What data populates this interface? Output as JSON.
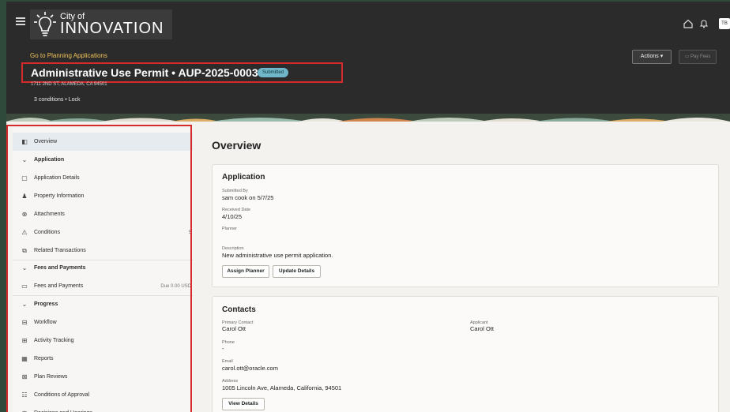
{
  "header": {
    "logo_small": "City of",
    "logo_big": "INNOVATION",
    "back_link": "Go to Planning Applications",
    "title": "Administrative Use Permit • AUP-2025-0003",
    "status": "Submitted",
    "address": "1711 2ND ST, ALAMEDA, CA 94501",
    "conditions_line": "3 conditions • Lock",
    "actions_label": "Actions",
    "pay_fees_label": "Pay Fees",
    "avatar_initials": "TB"
  },
  "sidebar": {
    "items": [
      {
        "label": "Overview",
        "icon": "panel-icon",
        "glyph": "◧"
      },
      {
        "label": "Application",
        "icon": "chevron-down-icon",
        "glyph": "⌄"
      },
      {
        "label": "Application Details",
        "icon": "document-icon",
        "glyph": "▢"
      },
      {
        "label": "Property Information",
        "icon": "person-icon",
        "glyph": "♟"
      },
      {
        "label": "Attachments",
        "icon": "paperclip-icon",
        "glyph": "⊗"
      },
      {
        "label": "Conditions",
        "icon": "warning-icon",
        "glyph": "⚠",
        "trail": "5"
      },
      {
        "label": "Related Transactions",
        "icon": "link-icon",
        "glyph": "⧉"
      },
      {
        "label": "Fees and Payments",
        "icon": "chevron-down-icon",
        "glyph": "⌄"
      },
      {
        "label": "Fees and Payments",
        "icon": "card-icon",
        "glyph": "▭",
        "trail": "Due 0.00 USD"
      },
      {
        "label": "Progress",
        "icon": "chevron-down-icon",
        "glyph": "⌄"
      },
      {
        "label": "Workflow",
        "icon": "workflow-icon",
        "glyph": "⊟"
      },
      {
        "label": "Activity Tracking",
        "icon": "tracking-icon",
        "glyph": "⊞"
      },
      {
        "label": "Reports",
        "icon": "report-icon",
        "glyph": "▦"
      },
      {
        "label": "Plan Reviews",
        "icon": "review-icon",
        "glyph": "⊠"
      },
      {
        "label": "Conditions of Approval",
        "icon": "checklist-icon",
        "glyph": "☷"
      },
      {
        "label": "Decisions and Hearings",
        "icon": "gavel-icon",
        "glyph": "⚖"
      }
    ]
  },
  "main": {
    "title": "Overview",
    "application": {
      "title": "Application",
      "submitted_by_label": "Submitted By",
      "submitted_by_value": "sam cook on 5/7/25",
      "received_label": "Received Date",
      "received_value": "4/10/25",
      "planner_label": "Planner",
      "description_label": "Description",
      "description_value": "New administrative use permit application.",
      "assign_planner": "Assign Planner",
      "update_details": "Update Details"
    },
    "contacts": {
      "title": "Contacts",
      "primary_label": "Primary Contact",
      "primary_value": "Carol Ott",
      "applicant_label": "Applicant",
      "applicant_value": "Carol  Ott",
      "phone_label": "Phone",
      "phone_value": "-",
      "email_label": "Email",
      "email_value": "carol.ott@oracle.com",
      "address_label": "Address",
      "address_value": "1005 Lincoln Ave, Alameda, California, 94501",
      "view_details": "View Details"
    }
  },
  "colors": {
    "header_bg": "#2b2b2b",
    "accent_link": "#f0c35a",
    "status_badge": "#6fb7c9",
    "highlight_box": "#d62b2b",
    "active_nav": "#e6ebef"
  }
}
